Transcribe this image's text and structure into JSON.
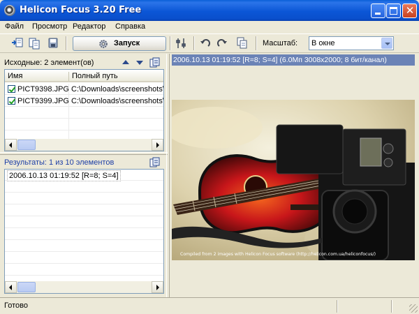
{
  "window": {
    "title": "Helicon Focus 3.20 Free"
  },
  "menu": [
    "Файл",
    "Просмотр",
    "Редактор",
    "Справка"
  ],
  "toolbar": {
    "run_label": "Запуск",
    "scale_label": "Масштаб:",
    "scale_value": "В окне",
    "icons": [
      "add-images-icon",
      "remove-images-icon",
      "save-icon",
      "settings-icon",
      "undo-icon",
      "redo-icon",
      "copy-icon"
    ]
  },
  "sources": {
    "header": "Исходные: 2 элемент(ов)",
    "columns": [
      "Имя",
      "Полный путь"
    ],
    "rows": [
      {
        "checked": true,
        "name": "PICT9398.JPG",
        "path": "C:\\Downloads\\screenshots\\fo"
      },
      {
        "checked": true,
        "name": "PICT9399.JPG",
        "path": "C:\\Downloads\\screenshots\\fo"
      }
    ]
  },
  "results": {
    "header": "Результаты: 1 из 10 элементов",
    "items": [
      "2006.10.13 01:19:52 [R=8; S=4]"
    ]
  },
  "preview": {
    "info": "2006.10.13 01:19:52 [R=8; S=4] (6.0Мп 3008x2000; 8 бит/канал)",
    "caption": "Compiled from 2 images with Helicon Focus software (http://helicon.com.ua/heliconfocus/)"
  },
  "status": {
    "text": "Готово"
  },
  "colors": {
    "titlebar": "#0a5fd8",
    "info_bar": "#6b83b6",
    "results_label": "#1d3ea6"
  }
}
